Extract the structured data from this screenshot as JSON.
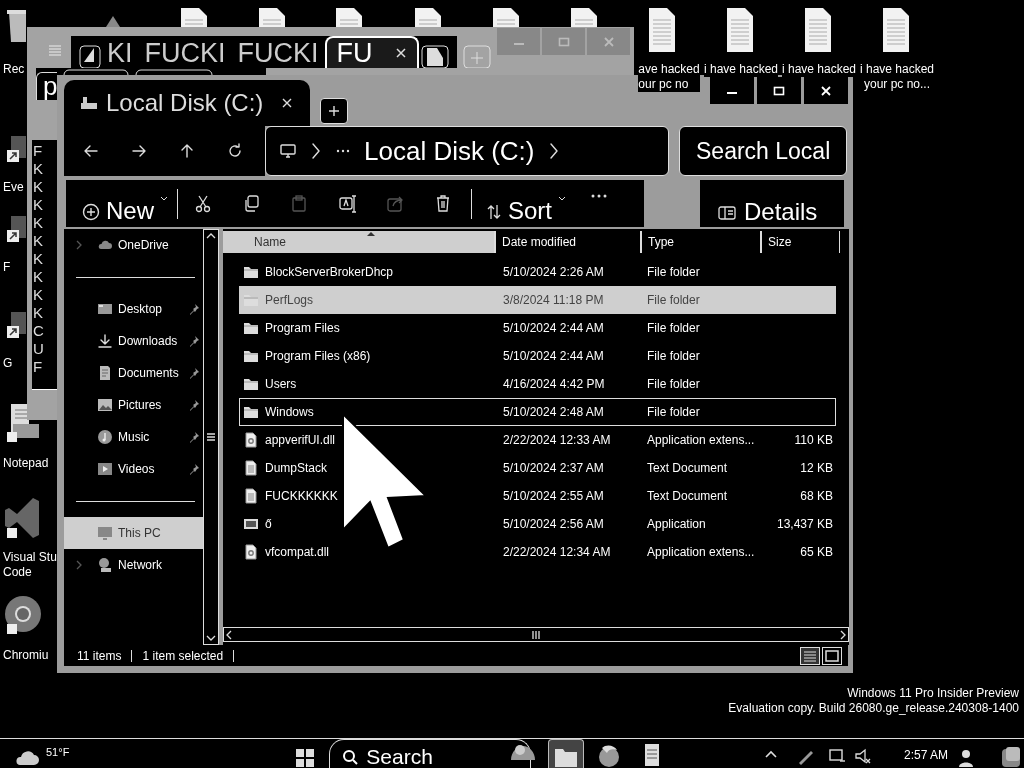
{
  "desktop": {
    "icons": [
      {
        "kind": "bin",
        "label_lines": [
          "Rec"
        ]
      },
      {
        "kind": "app"
      },
      {
        "kind": "document"
      },
      {
        "kind": "document"
      },
      {
        "kind": "document"
      },
      {
        "kind": "document"
      },
      {
        "kind": "document"
      },
      {
        "kind": "document"
      },
      {
        "kind": "document",
        "label_lines": [
          "ave hacked",
          "our pc no"
        ]
      },
      {
        "kind": "document",
        "label_lines": [
          "i have hacked"
        ]
      },
      {
        "kind": "document",
        "label_lines": [
          "i have hacked"
        ]
      },
      {
        "kind": "document",
        "label_lines": [
          "i have hacked",
          "your pc no..."
        ]
      }
    ],
    "side_icons": [
      {
        "kind": "shortcut",
        "label_lines": [
          "Eve"
        ]
      },
      {
        "kind": "shortcut",
        "label_lines": [
          "F"
        ]
      },
      {
        "kind": "shortcut",
        "label_lines": [
          "G"
        ]
      },
      {
        "kind": "notepad",
        "label_lines": [
          "Notepad"
        ]
      },
      {
        "kind": "code",
        "label_lines": [
          "Visual Stu",
          "Code"
        ]
      },
      {
        "kind": "browser",
        "label_lines": [
          "Chromiu"
        ]
      }
    ]
  },
  "back_window": {
    "tabs": [
      {
        "label": "KI",
        "selected": false
      },
      {
        "label": "FUCKI",
        "selected": false
      },
      {
        "label": "FUCKI",
        "selected": false
      },
      {
        "label": "FU",
        "selected": true
      }
    ],
    "lower_tab": {
      "label": "p"
    },
    "list_letters": [
      "F",
      "K",
      "K",
      "K",
      "K",
      "K",
      "K",
      "K",
      "K",
      "K",
      "C",
      "U",
      "F"
    ]
  },
  "explorer": {
    "tab": {
      "title": "Local Disk (C:)"
    },
    "address": {
      "location": "Local Disk (C:)"
    },
    "search": {
      "placeholder": "Search Local"
    },
    "toolbar": {
      "new_label": "New",
      "tools": [
        {
          "kind": "cut",
          "disabled": false
        },
        {
          "kind": "copy",
          "disabled": false
        },
        {
          "kind": "paste",
          "disabled": true
        },
        {
          "kind": "rename",
          "disabled": false
        },
        {
          "kind": "share",
          "disabled": true
        },
        {
          "kind": "delete",
          "disabled": false
        }
      ],
      "sort_label": "Sort",
      "details_label": "Details"
    },
    "nav_pane": {
      "groups": [
        [
          {
            "label": "OneDrive",
            "kind": "cloud",
            "expandable": true,
            "pinned": false,
            "selected": false
          }
        ],
        [
          {
            "label": "Desktop",
            "kind": "desktop",
            "expandable": false,
            "pinned": true,
            "selected": false
          },
          {
            "label": "Downloads",
            "kind": "download",
            "expandable": false,
            "pinned": true,
            "selected": false
          },
          {
            "label": "Documents",
            "kind": "documents",
            "expandable": false,
            "pinned": true,
            "selected": false
          },
          {
            "label": "Pictures",
            "kind": "pictures",
            "expandable": false,
            "pinned": true,
            "selected": false
          },
          {
            "label": "Music",
            "kind": "music",
            "expandable": false,
            "pinned": true,
            "selected": false
          },
          {
            "label": "Videos",
            "kind": "videos",
            "expandable": false,
            "pinned": true,
            "selected": false
          }
        ],
        [
          {
            "label": "This PC",
            "kind": "pc",
            "expandable": false,
            "pinned": false,
            "selected": true
          },
          {
            "label": "Network",
            "kind": "network",
            "expandable": true,
            "pinned": false,
            "selected": false
          }
        ]
      ]
    },
    "file_list": {
      "columns": [
        {
          "label": "Name",
          "sorted": true
        },
        {
          "label": "Date modified",
          "sorted": false
        },
        {
          "label": "Type",
          "sorted": false
        },
        {
          "label": "Size",
          "sorted": false
        }
      ],
      "rows": [
        {
          "name": "BlockServerBrokerDhcp",
          "kind": "folder",
          "date": "5/10/2024 2:26 AM",
          "type": "File folder",
          "selected": false,
          "focused": false
        },
        {
          "name": "PerfLogs",
          "kind": "folder",
          "date": "3/8/2024 11:18 PM",
          "type": "File folder",
          "selected": true,
          "focused": false
        },
        {
          "name": "Program Files",
          "kind": "folder",
          "date": "5/10/2024 2:44 AM",
          "type": "File folder",
          "selected": false,
          "focused": false
        },
        {
          "name": "Program Files (x86)",
          "kind": "folder",
          "date": "5/10/2024 2:44 AM",
          "type": "File folder",
          "selected": false,
          "focused": false
        },
        {
          "name": "Users",
          "kind": "folder",
          "date": "4/16/2024 4:42 PM",
          "type": "File folder",
          "selected": false,
          "focused": false
        },
        {
          "name": "Windows",
          "kind": "folder",
          "date": "5/10/2024 2:48 AM",
          "type": "File folder",
          "selected": false,
          "focused": true
        },
        {
          "name": "appverifUI.dll",
          "kind": "dll",
          "date": "2/22/2024 12:33 AM",
          "type": "Application extens...",
          "size": "110 KB",
          "selected": false,
          "focused": false
        },
        {
          "name": "DumpStack",
          "kind": "text",
          "date": "5/10/2024 2:37 AM",
          "type": "Text Document",
          "size": "12 KB",
          "selected": false,
          "focused": false
        },
        {
          "name": "FUCKKKKKK",
          "kind": "text",
          "date": "5/10/2024 2:55 AM",
          "type": "Text Document",
          "size": "68 KB",
          "selected": false,
          "focused": false
        },
        {
          "name": "ő",
          "kind": "app",
          "date": "5/10/2024 2:56 AM",
          "type": "Application",
          "size": "13,437 KB",
          "selected": false,
          "focused": false
        },
        {
          "name": "vfcompat.dll",
          "kind": "dll",
          "date": "2/22/2024 12:34 AM",
          "type": "Application extens...",
          "size": "65 KB",
          "selected": false,
          "focused": false
        }
      ]
    },
    "status_bar": {
      "item_count": "11 items",
      "selection": "1 item selected"
    }
  },
  "os_notice": [
    "Windows 11 Pro Insider Preview",
    "Evaluation copy. Build 26080.ge_release.240308-1400"
  ],
  "taskbar": {
    "weather": {
      "temperature": "51°F"
    },
    "search": {
      "label": "Search"
    },
    "apps": [
      {
        "kind": "copilot",
        "active": false
      },
      {
        "kind": "explorer",
        "active": true
      },
      {
        "kind": "browser",
        "active": false
      },
      {
        "kind": "notepad",
        "active": false
      }
    ],
    "clock": {
      "time": "2:57 AM"
    }
  }
}
